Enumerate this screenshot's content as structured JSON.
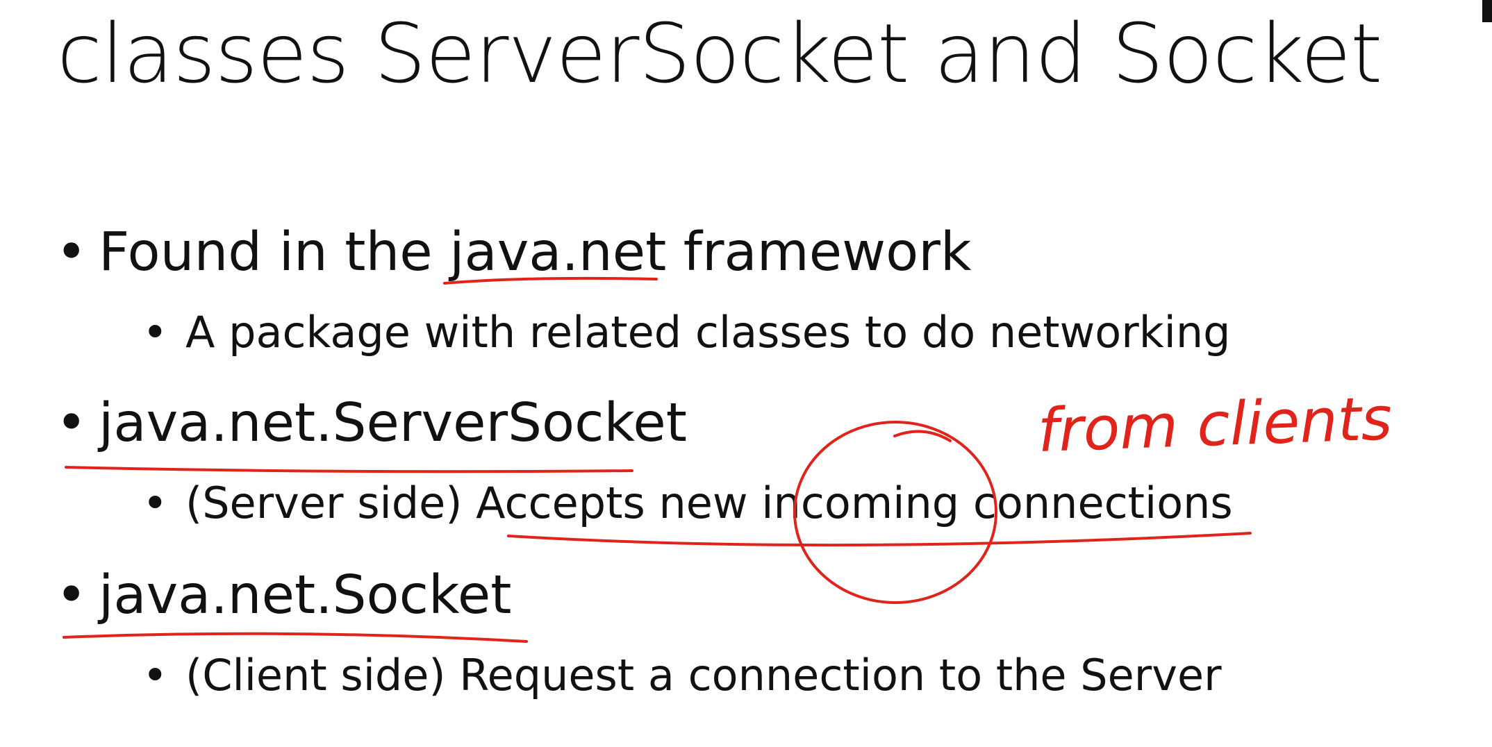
{
  "slide": {
    "title": "classes ServerSocket and Socket",
    "bullets": [
      {
        "text": "Found in the java.net framework",
        "sub": "A package with related classes to do networking"
      },
      {
        "text": "java.net.ServerSocket",
        "sub": "(Server side) Accepts new incoming connections"
      },
      {
        "text": "java.net.Socket",
        "sub": "(Client side) Request a connection to the Server"
      }
    ],
    "bullet_glyph": "•",
    "annotation": "from clients",
    "ink_color": "#e0241b"
  }
}
